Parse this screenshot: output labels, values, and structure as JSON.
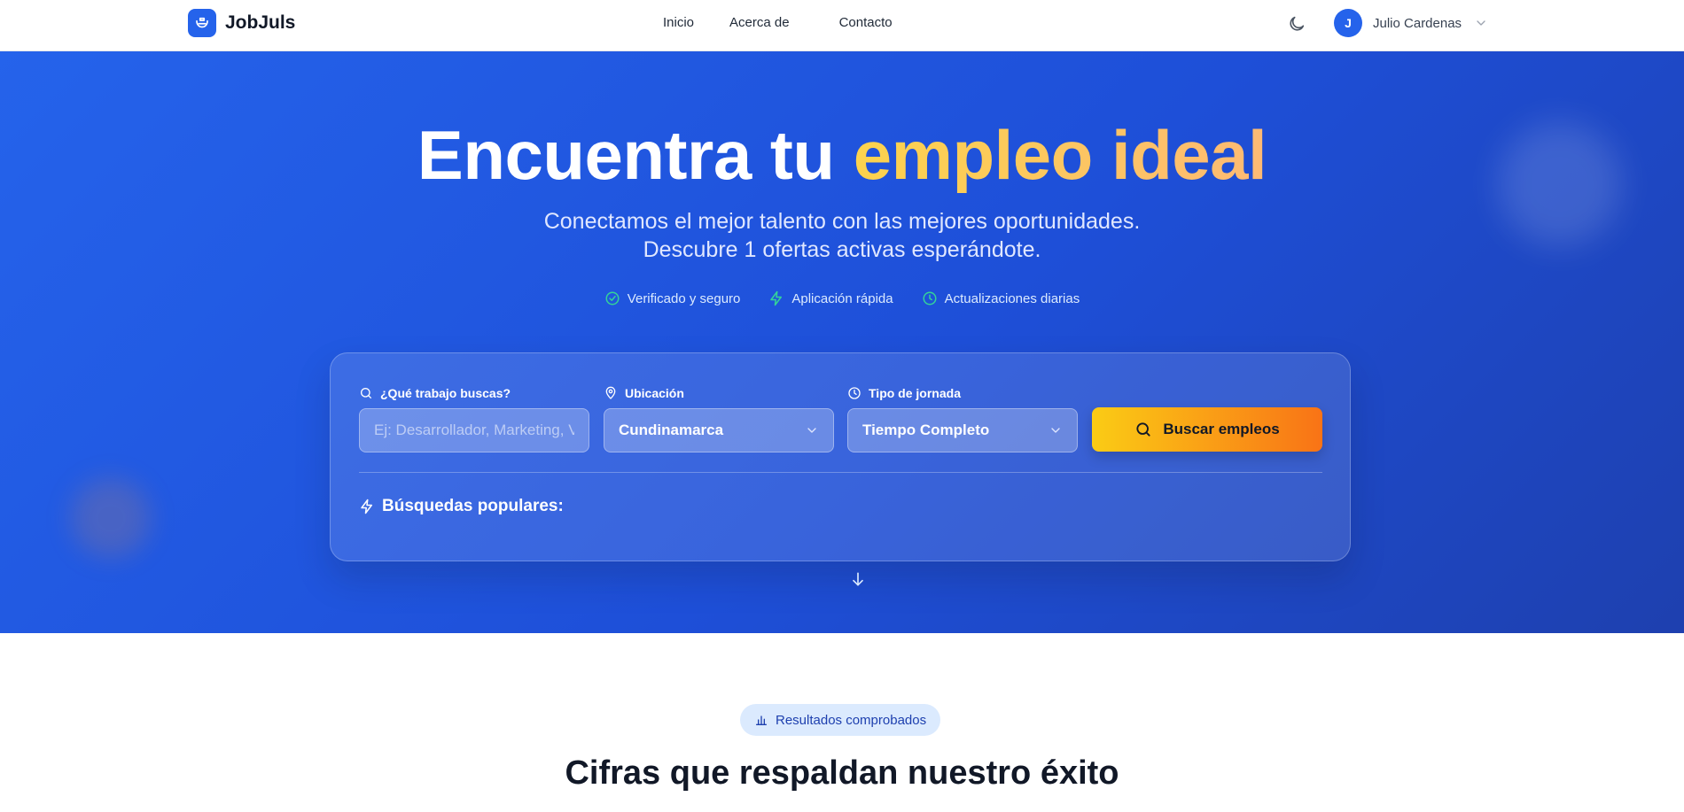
{
  "nav": {
    "brand": "JobJuls",
    "links": [
      "Inicio",
      "Acerca de",
      "Contacto"
    ],
    "user_initial": "J",
    "user_name": "Julio Cardenas"
  },
  "hero": {
    "title_main": "Encuentra tu ",
    "title_accent": "empleo ideal",
    "subtitle_line1": "Conectamos el mejor talento con las mejores oportunidades.",
    "subtitle_line2": "Descubre 1 ofertas activas esperándote.",
    "badges": [
      "Verificado y seguro",
      "Aplicación rápida",
      "Actualizaciones diarias"
    ]
  },
  "search": {
    "job_label": "¿Qué trabajo buscas?",
    "job_placeholder": "Ej: Desarrollador, Marketing, Ventas...",
    "location_label": "Ubicación",
    "location_value": "Cundinamarca",
    "type_label": "Tipo de jornada",
    "type_value": "Tiempo Completo",
    "button_label": "Buscar empleos",
    "popular_label": "Búsquedas populares:"
  },
  "stats": {
    "pill_label": "Resultados comprobados",
    "title": "Cifras que respaldan nuestro éxito"
  },
  "colors": {
    "primary": "#2563eb",
    "accent_start": "#facc15",
    "accent_end": "#f97316",
    "badge_icon": "#34d399"
  },
  "icons": [
    "briefcase-icon",
    "moon-icon",
    "chevron-down-icon",
    "check-circle-icon",
    "bolt-icon",
    "clock-icon",
    "search-icon",
    "map-pin-icon",
    "arrow-down-icon",
    "bar-chart-icon"
  ]
}
